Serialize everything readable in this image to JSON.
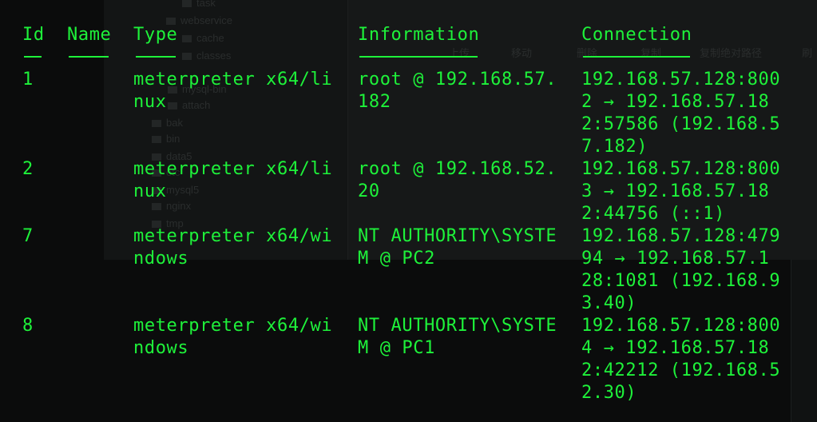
{
  "background_window": {
    "tree_items": [
      "task",
      "webservice",
      "cache",
      "classes",
      "mysql-bin",
      "attach",
      "bak",
      "bin",
      "data5",
      "etc",
      "mysql5",
      "nginx",
      "tmp"
    ],
    "toolbar_items": [
      "上传",
      "移动",
      "删除",
      "复制",
      "复制绝对路径",
      "刷"
    ]
  },
  "terminal": {
    "headers": {
      "id": "Id",
      "name": "Name",
      "type": "Type",
      "information": "Information",
      "connection": "Connection"
    },
    "sessions": [
      {
        "id": "1",
        "name": "",
        "type_lines": [
          "meterpreter x64/li",
          "nux"
        ],
        "info_lines": [
          "root @ 192.168.57.",
          "182"
        ],
        "conn_lines": [
          "192.168.57.128:800",
          "2 → 192.168.57.18",
          "2:57586 (192.168.5",
          "7.182)"
        ]
      },
      {
        "id": "2",
        "name": "",
        "type_lines": [
          "meterpreter x64/li",
          "nux"
        ],
        "info_lines": [
          "root @ 192.168.52.",
          "20"
        ],
        "conn_lines": [
          "192.168.57.128:800",
          "3 → 192.168.57.18",
          "2:44756 (::1)"
        ]
      },
      {
        "id": "7",
        "name": "",
        "type_lines": [
          "meterpreter x64/wi",
          "ndows"
        ],
        "info_lines": [
          "NT AUTHORITY\\SYSTE",
          "M @ PC2"
        ],
        "conn_lines": [
          "192.168.57.128:479",
          "94 → 192.168.57.1",
          "28:1081 (192.168.9",
          "3.40)"
        ]
      },
      {
        "id": "8",
        "name": "",
        "type_lines": [
          "meterpreter x64/wi",
          "ndows"
        ],
        "info_lines": [
          "NT AUTHORITY\\SYSTE",
          "M @ PC1"
        ],
        "conn_lines": [
          "192.168.57.128:800",
          "4 → 192.168.57.18",
          "2:42212 (192.168.5",
          "2.30)"
        ]
      }
    ]
  },
  "colors": {
    "terminal_text": "#1ef23a",
    "background": "#0b0c0c"
  }
}
